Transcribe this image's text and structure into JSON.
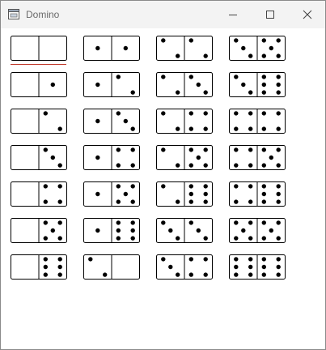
{
  "window": {
    "title": "Domino",
    "icon": "app-window-icon",
    "buttons": [
      {
        "name": "minimize-button",
        "icon": "minimize-icon"
      },
      {
        "name": "maximize-button",
        "icon": "maximize-icon"
      },
      {
        "name": "close-button",
        "icon": "close-icon"
      }
    ]
  },
  "colors": {
    "tile_border": "#000000",
    "pip": "#000000",
    "selection": "#c0392b",
    "titlebar": "#f3f3f3"
  },
  "dominoes": {
    "selected_index": 0,
    "tiles": [
      [
        0,
        0
      ],
      [
        0,
        1
      ],
      [
        0,
        2
      ],
      [
        0,
        3
      ],
      [
        0,
        4
      ],
      [
        0,
        5
      ],
      [
        0,
        6
      ],
      [
        1,
        1
      ],
      [
        1,
        2
      ],
      [
        1,
        3
      ],
      [
        1,
        4
      ],
      [
        1,
        5
      ],
      [
        1,
        6
      ],
      [
        2,
        0
      ],
      [
        2,
        2
      ],
      [
        2,
        3
      ],
      [
        2,
        4
      ],
      [
        2,
        5
      ],
      [
        2,
        6
      ],
      [
        3,
        3
      ],
      [
        3,
        4
      ],
      [
        3,
        5
      ],
      [
        3,
        6
      ],
      [
        4,
        4
      ],
      [
        4,
        5
      ],
      [
        4,
        6
      ],
      [
        5,
        5
      ],
      [
        6,
        6
      ]
    ]
  }
}
